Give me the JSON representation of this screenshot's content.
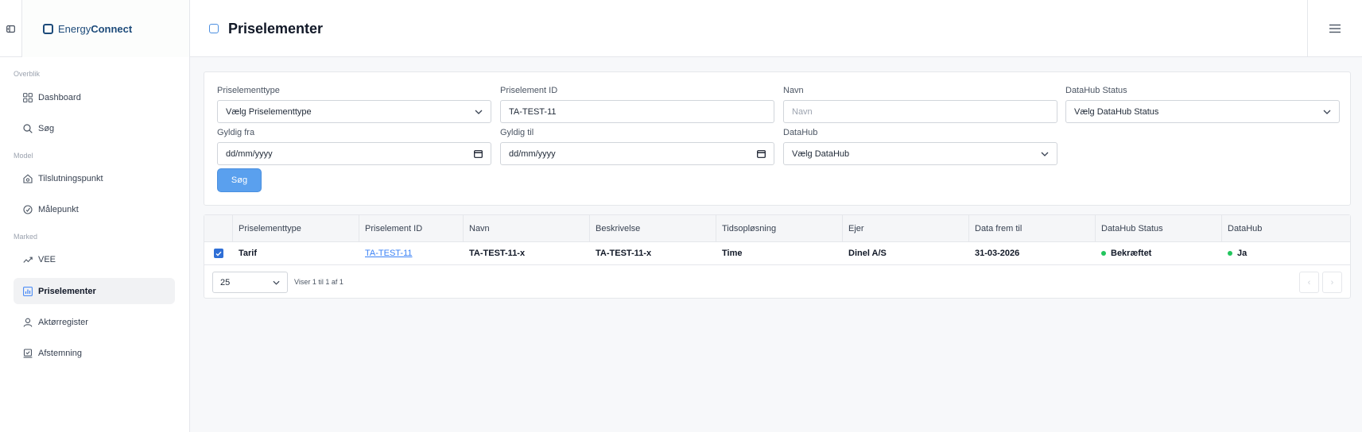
{
  "brand": {
    "name_light": "Energy",
    "name_bold": "Connect"
  },
  "page": {
    "title": "Priselementer"
  },
  "sidebar": {
    "sections": [
      {
        "label": "Overblik"
      },
      {
        "label": "Model"
      },
      {
        "label": "Marked"
      }
    ],
    "items": [
      {
        "label": "Dashboard",
        "icon": "dashboard-icon"
      },
      {
        "label": "Søg",
        "icon": "search-icon"
      },
      {
        "label": "Tilslutningspunkt",
        "icon": "house-icon"
      },
      {
        "label": "Målepunkt",
        "icon": "gauge-icon"
      },
      {
        "label": "VEE",
        "icon": "trend-icon"
      },
      {
        "label": "Priselementer",
        "icon": "chart-icon",
        "active": true
      },
      {
        "label": "Aktørregister",
        "icon": "user-icon"
      },
      {
        "label": "Afstemning",
        "icon": "reconcile-icon"
      }
    ]
  },
  "filters": {
    "type": {
      "label": "Priselementtype",
      "value": "Vælg Priselementtype"
    },
    "id": {
      "label": "Priselement ID",
      "value": "TA-TEST-11"
    },
    "name": {
      "label": "Navn",
      "placeholder": "Navn"
    },
    "datahub_status": {
      "label": "DataHub Status",
      "value": "Vælg DataHub Status"
    },
    "valid_from": {
      "label": "Gyldig fra",
      "value": "dd/mm/yyyy"
    },
    "valid_to": {
      "label": "Gyldig til",
      "value": "dd/mm/yyyy"
    },
    "datahub": {
      "label": "DataHub",
      "value": "Vælg DataHub"
    },
    "search_label": "Søg"
  },
  "table": {
    "columns": [
      "Priselementtype",
      "Priselement ID",
      "Navn",
      "Beskrivelse",
      "Tidsopløsning",
      "Ejer",
      "Data frem til",
      "DataHub Status",
      "DataHub"
    ],
    "rows": [
      {
        "checked": true,
        "cells": [
          "Tarif",
          "TA-TEST-11",
          "TA-TEST-11-x",
          "TA-TEST-11-x",
          "Time",
          "Dinel A/S",
          "31-03-2026",
          "Bekræftet",
          "Ja"
        ]
      }
    ],
    "status_color": "#22c55e"
  },
  "pagination": {
    "page_size": "25",
    "info": "Viser 1 til 1 af 1",
    "prev": "‹",
    "next": "›"
  }
}
